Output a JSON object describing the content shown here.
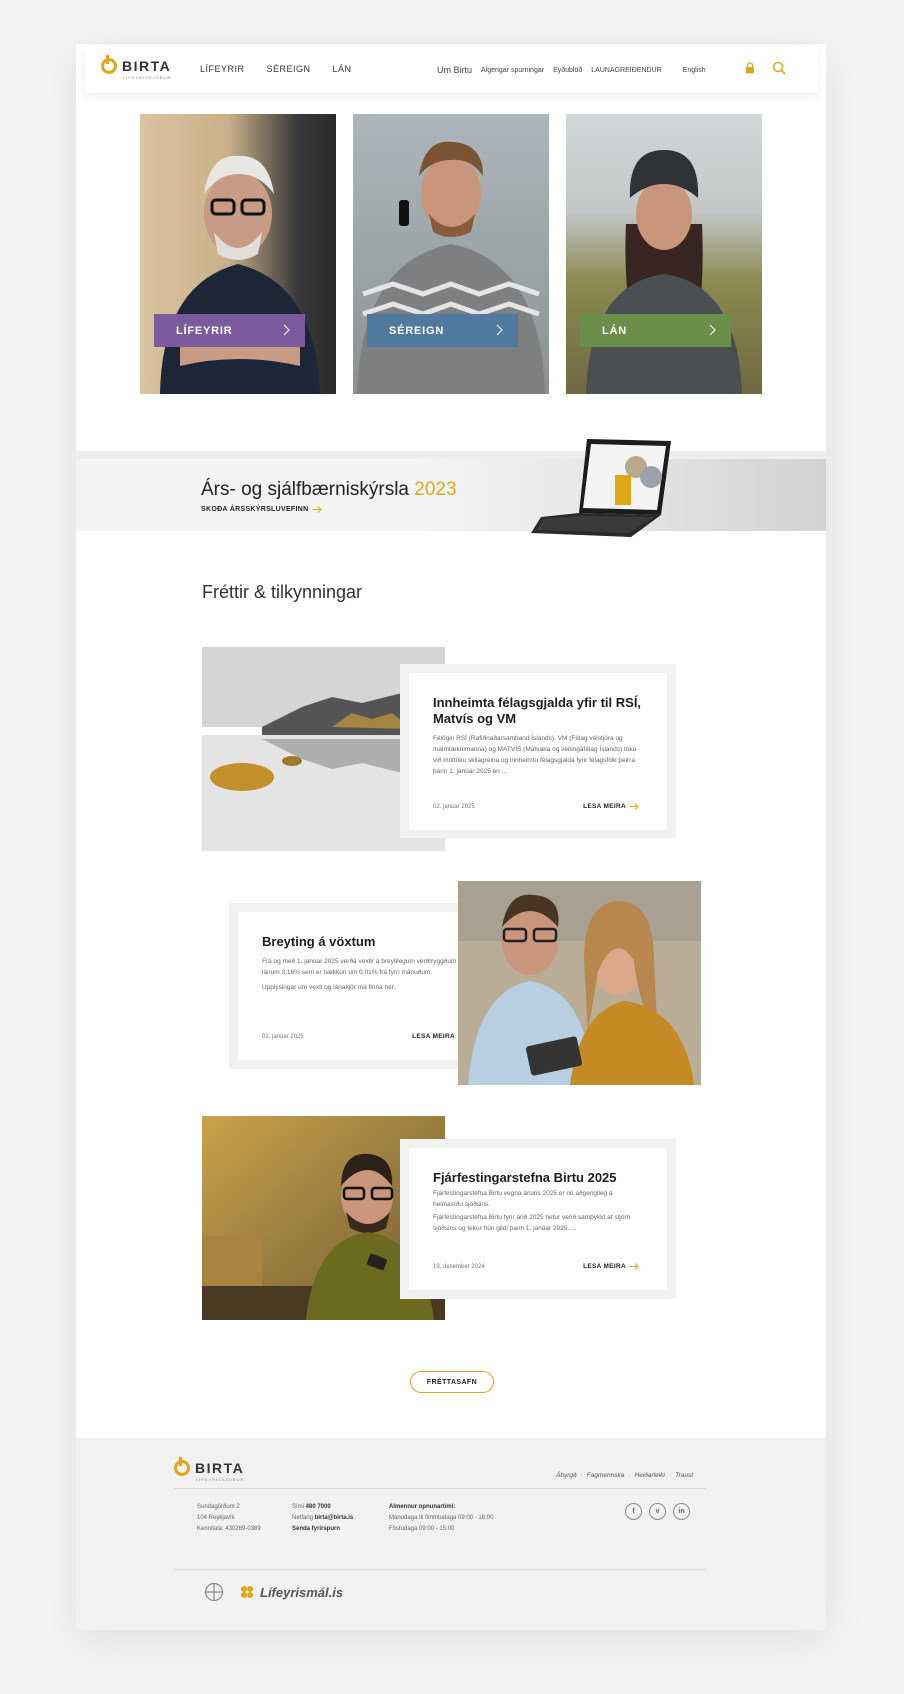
{
  "header": {
    "logo_text": "BIRTA",
    "logo_sub": "LÍFEYRISSJÓÐUR",
    "nav_main": [
      "LÍFEYRIR",
      "SÉREIGN",
      "LÁN"
    ],
    "nav_right": [
      "Um Birtu",
      "Algengar spurningar",
      "Eyðublöð",
      "LAUNAGREIÐENDUR",
      "English"
    ]
  },
  "hero": [
    {
      "label": "LÍFEYRIR",
      "color": "#7b5a9e"
    },
    {
      "label": "SÉREIGN",
      "color": "#4f7a9e"
    },
    {
      "label": "LÁN",
      "color": "#6b8f4a"
    }
  ],
  "report": {
    "title": "Árs- og sjálfbærniskýrsla ",
    "year": "2023",
    "link": "SKOÐA ÁRSSKÝRSLUVEFINN"
  },
  "news_title": "Fréttir & tilkynningar",
  "news": [
    {
      "title": "Innheimta félagsgjalda yfir til RSÍ, Matvís og VM",
      "text": "Félögin RSÍ (Rafiðnaðarsamband Íslands), VM (Félag vélstjóra og málmtæknimanna) og MATVÍS (Matvæla og veitingafélag Íslands) tóku við móttöku skilagreina og innheimtu félagsgjalda fyrir félagsfólk þeirra þann 1. janúar 2025 en ...",
      "date": "02. janúar 2025",
      "more": "LESA MEIRA"
    },
    {
      "title": "Breyting á vöxtum",
      "text": "Frá og með 1. janúar 2025 verða vextir á breytilegum verðtryggðum lánum 3,16% sem er hækkun um 0,01% frá fyrri mánuðum.",
      "text2": "Upplýsingar um vexti og lánakjör má finna hér.",
      "date": "02. janúar 2025",
      "more": "LESA MEIRA"
    },
    {
      "title": "Fjárfestingarstefna Birtu 2025",
      "text": "Fjárfestingarstefna Birtu vegna ársins 2025 er nú aðgengileg á heimasíðu sjóðsins.",
      "text2": "Fjárfestingarstefna Birtu fyrir árið 2025 hefur verið samþykkt af stjórn sjóðsins og tekur hún gildi þann 1. janúar 2025. ...",
      "date": "19. desember 2024",
      "more": "LESA MEIRA"
    }
  ],
  "archive_button": "FRÉTTASAFN",
  "footer": {
    "links": [
      "Ábyrgð",
      "Fagmennska",
      "Heiðarleiki",
      "Traust"
    ],
    "address": [
      "Sundagörðum 2",
      "104 Reykjavík",
      "Kennitala: 430269-0389"
    ],
    "phone_label": "Sími ",
    "phone": "480 7000",
    "email_label": "Netfang ",
    "email": "birta@birta.is",
    "inquiry": "Senda fyrirspurn",
    "hours_title": "Almennur opnunartími:",
    "hours": [
      "Mánudaga til fimmtudaga 09:00 - 16:00",
      "Föstudaga 09:00 - 15:00"
    ],
    "social": [
      "f",
      "v",
      "in"
    ],
    "partner": "Lífeyrismál.is"
  },
  "colors": {
    "accent": "#e0a818"
  }
}
